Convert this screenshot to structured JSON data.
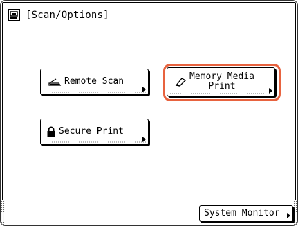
{
  "screen": {
    "title": "[Scan/Options]",
    "title_icon": "scan-options-icon"
  },
  "buttons": {
    "remote_scan": {
      "label": "Remote Scan",
      "icon": "scanner-icon"
    },
    "memory_media_print": {
      "label_line1": "Memory Media",
      "label_line2": "Print",
      "icon": "eraser-icon",
      "highlighted": true
    },
    "secure_print": {
      "label": "Secure Print",
      "icon": "lock-icon"
    }
  },
  "footer": {
    "system_monitor_label": "System Monitor"
  },
  "colors": {
    "highlight": "#e8633f",
    "text": "#000000",
    "background": "#ffffff"
  }
}
